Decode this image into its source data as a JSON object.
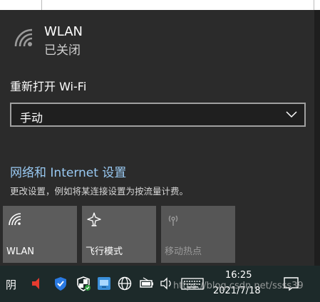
{
  "network": {
    "name": "WLAN",
    "status": "已关闭"
  },
  "reopen": {
    "label": "重新打开 Wi-Fi",
    "selected": "手动"
  },
  "settings": {
    "link": "网络和 Internet 设置",
    "description": "更改设置，例如将某连接设置为按流量计费。"
  },
  "quick_actions": [
    {
      "label": "WLAN",
      "icon": "wifi-icon"
    },
    {
      "label": "飞行模式",
      "icon": "airplane-icon"
    },
    {
      "label": "移动热点",
      "icon": "hotspot-icon"
    }
  ],
  "taskbar": {
    "ime": "阴",
    "time": "16:25",
    "date": "2021/7/18",
    "watermark": "https://blog.csdn.net/ssss39"
  },
  "colors": {
    "panel": "#2b2b2b",
    "link": "#99c9f2",
    "taskbar": "#1d2a2a"
  }
}
